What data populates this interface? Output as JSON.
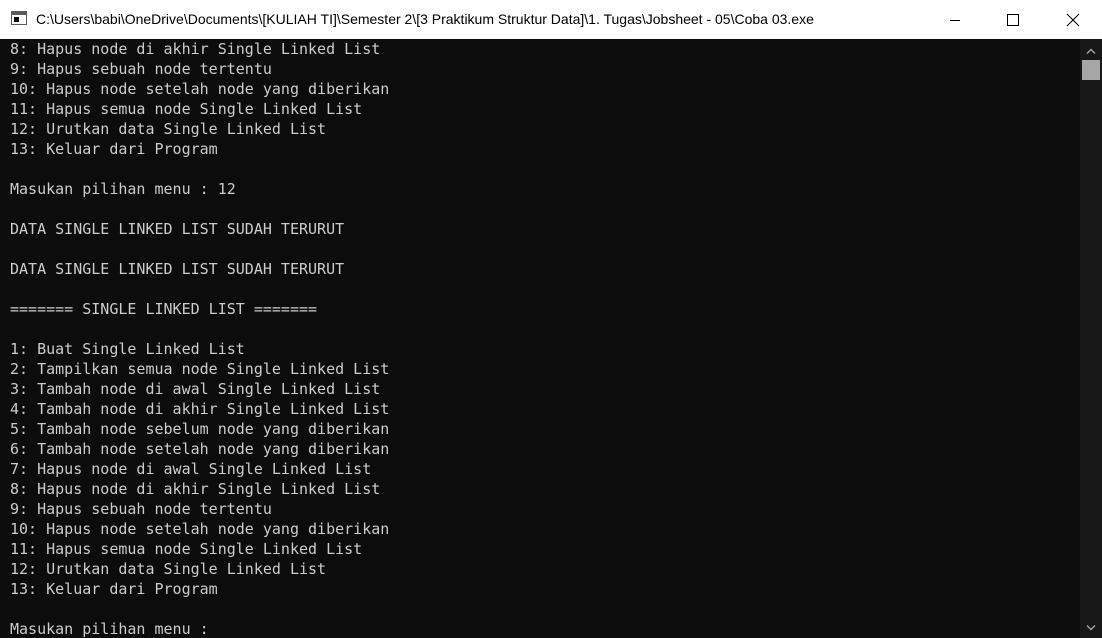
{
  "window": {
    "title": "C:\\Users\\babi\\OneDrive\\Documents\\[KULIAH TI]\\Semester 2\\[3 Praktikum Struktur Data]\\1. Tugas\\Jobsheet - 05\\Coba 03.exe",
    "icon": "console-app-icon",
    "controls": [
      "minimize-icon",
      "maximize-icon",
      "close-icon"
    ]
  },
  "console": {
    "lines": [
      "8: Hapus node di akhir Single Linked List",
      "9: Hapus sebuah node tertentu",
      "10: Hapus node setelah node yang diberikan",
      "11: Hapus semua node Single Linked List",
      "12: Urutkan data Single Linked List",
      "13: Keluar dari Program",
      "",
      "Masukan pilihan menu : 12",
      "",
      "DATA SINGLE LINKED LIST SUDAH TERURUT",
      "",
      "DATA SINGLE LINKED LIST SUDAH TERURUT",
      "",
      "======= SINGLE LINKED LIST =======",
      "",
      "1: Buat Single Linked List",
      "2: Tampilkan semua node Single Linked List",
      "3: Tambah node di awal Single Linked List",
      "4: Tambah node di akhir Single Linked List",
      "5: Tambah node sebelum node yang diberikan",
      "6: Tambah node setelah node yang diberikan",
      "7: Hapus node di awal Single Linked List",
      "8: Hapus node di akhir Single Linked List",
      "9: Hapus sebuah node tertentu",
      "10: Hapus node setelah node yang diberikan",
      "11: Hapus semua node Single Linked List",
      "12: Urutkan data Single Linked List",
      "13: Keluar dari Program",
      "",
      "Masukan pilihan menu :"
    ]
  },
  "colors": {
    "console_bg": "#0c0c0c",
    "console_text": "#cccccc",
    "titlebar_bg": "#ffffff",
    "scrollbar_thumb": "#a6a6a6"
  }
}
